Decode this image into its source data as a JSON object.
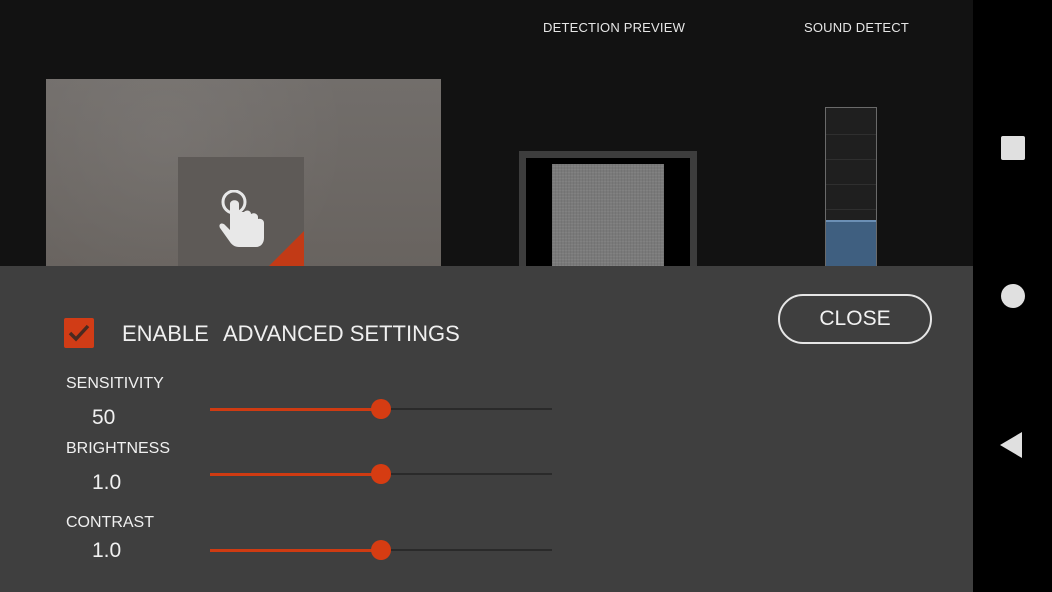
{
  "header": {
    "detection_preview_label": "DETECTION PREVIEW",
    "sound_detect_label": "SOUND DETECT"
  },
  "sound_meter": {
    "level": 0.3
  },
  "settings": {
    "enable_label": "ENABLE",
    "advanced_label": "ADVANCED SETTINGS",
    "enabled": true,
    "close_label": "CLOSE",
    "sliders": [
      {
        "label": "SENSITIVITY",
        "value": "50",
        "fraction": 0.5
      },
      {
        "label": "BRIGHTNESS",
        "value": "1.0",
        "fraction": 0.5
      },
      {
        "label": "CONTRAST",
        "value": "1.0",
        "fraction": 0.5
      }
    ]
  },
  "colors": {
    "accent": "#d13c16",
    "panel": "#3f3f3f",
    "background": "#121212",
    "meter_fill": "#3f5f80"
  },
  "icons": {
    "touch": "touch-hand-icon",
    "check": "check-icon",
    "nav_recent": "square-icon",
    "nav_home": "circle-icon",
    "nav_back": "triangle-back-icon"
  }
}
